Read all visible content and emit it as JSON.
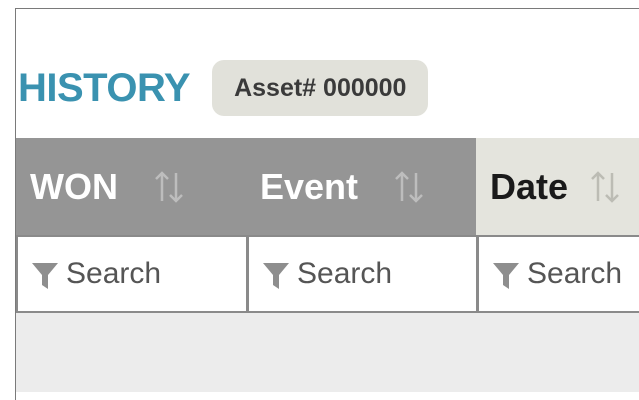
{
  "history": {
    "title": "HISTORY",
    "asset_badge": "Asset# 000000"
  },
  "table": {
    "columns": [
      {
        "label": "WON",
        "sort_icon": "sort-arrows-icon",
        "filter_placeholder": "Search",
        "style": "dark"
      },
      {
        "label": "Event",
        "sort_icon": "sort-arrows-icon",
        "filter_placeholder": "Search",
        "style": "dark"
      },
      {
        "label": "Date",
        "sort_icon": "sort-arrows-icon",
        "filter_placeholder": "Search",
        "style": "light"
      }
    ],
    "filter_icon": "funnel-icon"
  },
  "colors": {
    "accent": "#3a92b0",
    "header_dark": "#959595",
    "header_light": "#e4e4dd",
    "badge_bg": "#e1e1da",
    "body_bg": "#ececec"
  }
}
